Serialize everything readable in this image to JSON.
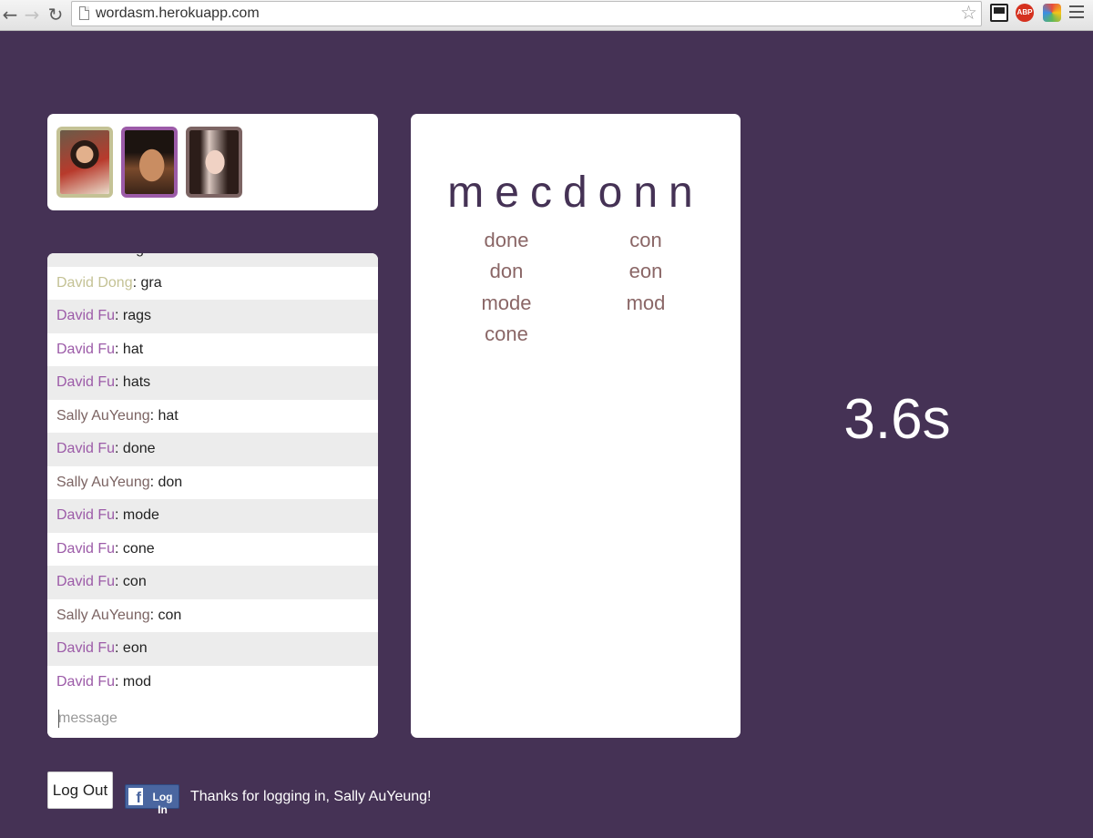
{
  "browser": {
    "url": "wordasm.herokuapp.com",
    "nav": {
      "back_icon": "←",
      "forward_icon": "→",
      "reload_icon": "↻"
    },
    "star_icon": "☆",
    "ext_abp_label": "ABP"
  },
  "game": {
    "letters": "mecdonn",
    "words_col1": [
      "done",
      "don",
      "mode",
      "cone"
    ],
    "words_col2": [
      "con",
      "eon",
      "mod"
    ],
    "timer": "3.6s"
  },
  "players": [
    {
      "name": "David Dong",
      "color": "#c4c295"
    },
    {
      "name": "David Fu",
      "color": "#9c5ba8"
    },
    {
      "name": "Sally AuYeung",
      "color": "#7c6463"
    }
  ],
  "chat": {
    "messages": [
      {
        "user": "David Fu",
        "text": "rag"
      },
      {
        "user": "David Dong",
        "text": "gra"
      },
      {
        "user": "David Fu",
        "text": "rags"
      },
      {
        "user": "David Fu",
        "text": "hat"
      },
      {
        "user": "David Fu",
        "text": "hats"
      },
      {
        "user": "Sally AuYeung",
        "text": "hat"
      },
      {
        "user": "David Fu",
        "text": "done"
      },
      {
        "user": "Sally AuYeung",
        "text": "don"
      },
      {
        "user": "David Fu",
        "text": "mode"
      },
      {
        "user": "David Fu",
        "text": "cone"
      },
      {
        "user": "David Fu",
        "text": "con"
      },
      {
        "user": "Sally AuYeung",
        "text": "con"
      },
      {
        "user": "David Fu",
        "text": "eon"
      },
      {
        "user": "David Fu",
        "text": "mod"
      }
    ],
    "input_placeholder": "message",
    "input_value": ""
  },
  "footer": {
    "logout_label": "Log Out",
    "fb_login_label": "Log In",
    "welcome": "Thanks for logging in, Sally AuYeung!"
  },
  "colors": {
    "background": "#453255",
    "word_color": "#8a6666"
  }
}
